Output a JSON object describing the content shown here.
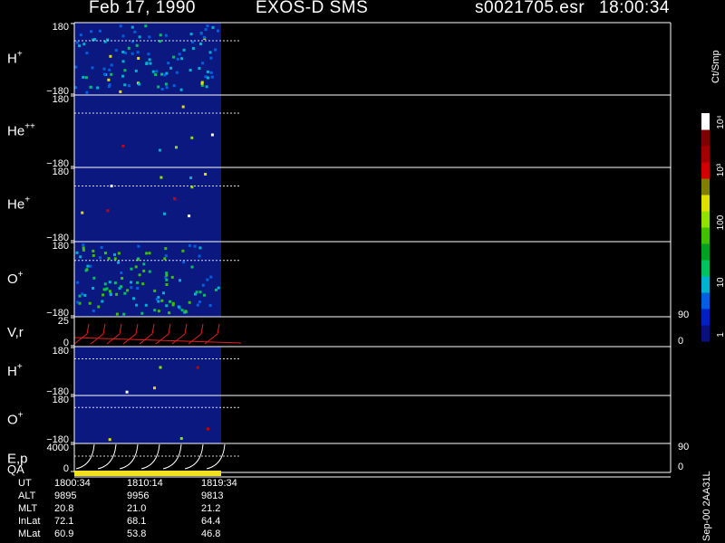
{
  "header": {
    "date": "Feb 17, 1990",
    "instrument": "EXOS-D SMS",
    "file": "s0021705.esr",
    "time": "18:00:34"
  },
  "colorbar": {
    "title": "Ct/Smp",
    "ticks": [
      "1",
      "10",
      "100",
      "10³",
      "10⁴"
    ],
    "colors": [
      "#0a0f80",
      "#0020c0",
      "#0060e0",
      "#00b0d0",
      "#00c060",
      "#00a020",
      "#40c000",
      "#90e000",
      "#e0e000",
      "#808000",
      "#d00000",
      "#a00000",
      "#800000",
      "#ffffff"
    ]
  },
  "panels": [
    {
      "id": "h-plus-1",
      "label_base": "H",
      "label_sup": "+",
      "ytop": "180",
      "ybot": "−180"
    },
    {
      "id": "he-plus-plus",
      "label_base": "He",
      "label_sup": "++",
      "ytop": "180",
      "ybot": "−180"
    },
    {
      "id": "he-plus",
      "label_base": "He",
      "label_sup": "+",
      "ytop": "180",
      "ybot": "−180"
    },
    {
      "id": "o-plus-1",
      "label_base": "O",
      "label_sup": "+",
      "ytop": "180",
      "ybot": "−180"
    },
    {
      "id": "vr",
      "label_base": "V,r",
      "label_sup": "",
      "ytop": "25",
      "ybot": "0",
      "right_top": "90",
      "right_bot": "0"
    },
    {
      "id": "h-plus-2",
      "label_base": "H",
      "label_sup": "+",
      "ytop": "180",
      "ybot": "−180"
    },
    {
      "id": "o-plus-2",
      "label_base": "O",
      "label_sup": "+",
      "ytop": "180",
      "ybot": "−180"
    },
    {
      "id": "ep",
      "label_base": "E,p",
      "label_sup": "",
      "ytop": "4000",
      "ybot": "0",
      "right_top": "90",
      "right_bot": "0"
    }
  ],
  "qa_label": "QA",
  "footer": {
    "rows": [
      {
        "label": "UT",
        "values": [
          "1800:34",
          "1810:14",
          "1819:34"
        ]
      },
      {
        "label": "ALT",
        "values": [
          "9895",
          "9956",
          "9813"
        ]
      },
      {
        "label": "MLT",
        "values": [
          "20.8",
          "21.0",
          "21.2"
        ]
      },
      {
        "label": "InLat",
        "values": [
          "72.1",
          "68.1",
          "64.4"
        ]
      },
      {
        "label": "MLat",
        "values": [
          "60.9",
          "53.8",
          "46.8"
        ]
      }
    ]
  },
  "side_text": "Sep-00  2AA31L",
  "chart_data": {
    "type": "heatmap",
    "title": "Feb 17, 1990   EXOS-D SMS",
    "x_label": "UT",
    "x_ticks": [
      "1800:34",
      "1810:14",
      "1819:34"
    ],
    "data_span_ut": [
      "1800:34",
      "1819:34"
    ],
    "colorbar": {
      "label": "Ct/Smp",
      "scale": "log",
      "range": [
        1,
        10000
      ]
    },
    "panels": [
      {
        "name": "H+",
        "y_range": [
          -180,
          180
        ]
      },
      {
        "name": "He++",
        "y_range": [
          -180,
          180
        ]
      },
      {
        "name": "He+",
        "y_range": [
          -180,
          180
        ]
      },
      {
        "name": "O+",
        "y_range": [
          -180,
          180
        ]
      },
      {
        "name": "V,r",
        "y_range": [
          0,
          25
        ],
        "right_axis": [
          0,
          90
        ]
      },
      {
        "name": "H+",
        "y_range": [
          -180,
          180
        ]
      },
      {
        "name": "O+",
        "y_range": [
          -180,
          180
        ]
      },
      {
        "name": "E,p",
        "y_range": [
          0,
          4000
        ],
        "right_axis": [
          0,
          90
        ]
      }
    ]
  }
}
